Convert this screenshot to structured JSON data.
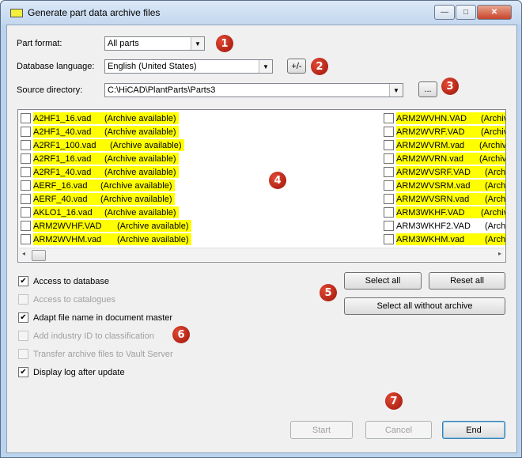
{
  "window": {
    "title": "Generate part data archive files",
    "min": "—",
    "max": "□",
    "close": "✕"
  },
  "form": {
    "part_format": {
      "label": "Part format:",
      "value": "All parts"
    },
    "database_language": {
      "label": "Database language:",
      "value": "English (United States)",
      "button": "+/-"
    },
    "source_directory": {
      "label": "Source directory:",
      "value": "C:\\HiCAD\\PlantParts\\Parts3",
      "button": "..."
    }
  },
  "file_list": {
    "left": [
      {
        "name": "A2HF1_16.vad",
        "status": "(Archive available)",
        "checked": false,
        "highlighted": true
      },
      {
        "name": "A2HF1_40.vad",
        "status": "(Archive available)",
        "checked": false,
        "highlighted": true
      },
      {
        "name": "A2RF1_100.vad",
        "status": "(Archive available)",
        "checked": false,
        "highlighted": true
      },
      {
        "name": "A2RF1_16.vad",
        "status": "(Archive available)",
        "checked": false,
        "highlighted": true
      },
      {
        "name": "A2RF1_40.vad",
        "status": "(Archive available)",
        "checked": false,
        "highlighted": true
      },
      {
        "name": "AERF_16.vad",
        "status": "(Archive available)",
        "checked": false,
        "highlighted": true
      },
      {
        "name": "AERF_40.vad",
        "status": "(Archive available)",
        "checked": false,
        "highlighted": true
      },
      {
        "name": "AKLO1_16.vad",
        "status": "(Archive available)",
        "checked": false,
        "highlighted": true
      },
      {
        "name": "ARM2WVHF.VAD",
        "status": "(Archive available)",
        "checked": false,
        "highlighted": true
      },
      {
        "name": "ARM2WVHM.vad",
        "status": "(Archive available)",
        "checked": false,
        "highlighted": true
      }
    ],
    "right": [
      {
        "name": "ARM2WVHN.VAD",
        "status": "(Archiv",
        "checked": false,
        "highlighted": true
      },
      {
        "name": "ARM2WVRF.VAD",
        "status": "(Archiv",
        "checked": false,
        "highlighted": true
      },
      {
        "name": "ARM2WVRM.vad",
        "status": "(Archiv",
        "checked": false,
        "highlighted": true
      },
      {
        "name": "ARM2WVRN.vad",
        "status": "(Archiv",
        "checked": false,
        "highlighted": true
      },
      {
        "name": "ARM2WVSRF.VAD",
        "status": "(Archi",
        "checked": false,
        "highlighted": true
      },
      {
        "name": "ARM2WVSRM.vad",
        "status": "(Archi",
        "checked": false,
        "highlighted": true
      },
      {
        "name": "ARM2WVSRN.vad",
        "status": "(Archi",
        "checked": false,
        "highlighted": true
      },
      {
        "name": "ARM3WKHF.VAD",
        "status": "(Archiv",
        "checked": false,
        "highlighted": true
      },
      {
        "name": "ARM3WKHF2.VAD",
        "status": "(Archi",
        "checked": false,
        "highlighted": false
      },
      {
        "name": "ARM3WKHM.vad",
        "status": "(Archi",
        "checked": false,
        "highlighted": true
      }
    ]
  },
  "scrollbar": {
    "left_arrow": "◂",
    "right_arrow": "▸"
  },
  "options": [
    {
      "label": "Access to database",
      "checked": true,
      "enabled": true
    },
    {
      "label": "Access to catalogues",
      "checked": false,
      "enabled": false
    },
    {
      "label": "Adapt file name in document master",
      "checked": true,
      "enabled": true
    },
    {
      "label": "Add industry ID to classification",
      "checked": false,
      "enabled": false
    },
    {
      "label": "Transfer archive files to Vault Server",
      "checked": false,
      "enabled": false
    },
    {
      "label": "Display log after update",
      "checked": true,
      "enabled": true
    }
  ],
  "buttons": {
    "select_all": "Select all",
    "reset_all": "Reset all",
    "select_all_without_archive": "Select all without archive",
    "start": "Start",
    "cancel": "Cancel",
    "end": "End"
  },
  "badges": [
    "1",
    "2",
    "3",
    "4",
    "5",
    "6",
    "7"
  ],
  "colors": {
    "highlight": "#ffff00",
    "badge": "#c0200f",
    "title_bar": "#c9dcf2"
  },
  "icons": {
    "dropdown": "▼",
    "checkmark": "✔"
  }
}
